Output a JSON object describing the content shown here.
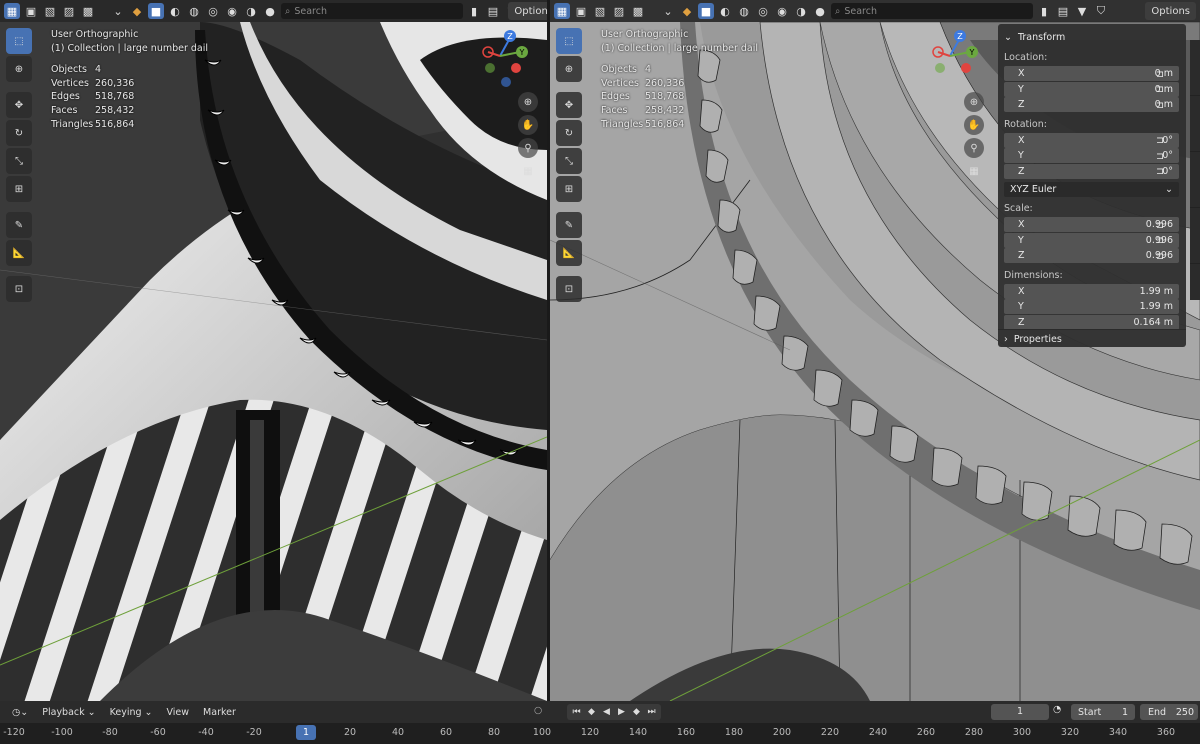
{
  "left_viewport": {
    "search_placeholder": "Search",
    "options_label": "Options",
    "view_name": "User Orthographic",
    "collection": "(1) Collection | large number dail",
    "stats": [
      {
        "label": "Objects",
        "value": "4"
      },
      {
        "label": "Vertices",
        "value": "260,336"
      },
      {
        "label": "Edges",
        "value": "518,768"
      },
      {
        "label": "Faces",
        "value": "258,432"
      },
      {
        "label": "Triangles",
        "value": "516,864"
      }
    ]
  },
  "right_viewport": {
    "search_placeholder": "Search",
    "options_label": "Options",
    "view_name": "User Orthographic",
    "collection": "(1) Collection | large number dail",
    "stats": [
      {
        "label": "Objects",
        "value": "4"
      },
      {
        "label": "Vertices",
        "value": "260,336"
      },
      {
        "label": "Edges",
        "value": "518,768"
      },
      {
        "label": "Faces",
        "value": "258,432"
      },
      {
        "label": "Triangles",
        "value": "516,864"
      }
    ]
  },
  "gizmo_axes": {
    "x": "X",
    "y": "Y",
    "z": "Z"
  },
  "transform_panel": {
    "title": "Transform",
    "location_label": "Location:",
    "location": [
      {
        "axis": "X",
        "value": "0 m"
      },
      {
        "axis": "Y",
        "value": "0 m"
      },
      {
        "axis": "Z",
        "value": "0 m"
      }
    ],
    "rotation_label": "Rotation:",
    "rotation": [
      {
        "axis": "X",
        "value": "0°"
      },
      {
        "axis": "Y",
        "value": "0°"
      },
      {
        "axis": "Z",
        "value": "0°"
      }
    ],
    "rotation_mode": "XYZ Euler",
    "scale_label": "Scale:",
    "scale": [
      {
        "axis": "X",
        "value": "0.996"
      },
      {
        "axis": "Y",
        "value": "0.996"
      },
      {
        "axis": "Z",
        "value": "0.996"
      }
    ],
    "dimensions_label": "Dimensions:",
    "dimensions": [
      {
        "axis": "X",
        "value": "1.99 m"
      },
      {
        "axis": "Y",
        "value": "1.99 m"
      },
      {
        "axis": "Z",
        "value": "0.164 m"
      }
    ],
    "properties_label": "Properties"
  },
  "timeline": {
    "playback_label": "Playback",
    "keying_label": "Keying",
    "view_label": "View",
    "marker_label": "Marker",
    "current_frame": "1",
    "start_label": "Start",
    "start_value": "1",
    "end_label": "End",
    "end_value": "250",
    "ruler_current": "1",
    "ruler_ticks": [
      "-120",
      "-100",
      "-80",
      "-60",
      "-40",
      "-20",
      "20",
      "40",
      "60",
      "80",
      "100",
      "120",
      "140",
      "160",
      "180",
      "200",
      "220",
      "240",
      "260",
      "280",
      "300",
      "320",
      "340",
      "360"
    ]
  },
  "colors": {
    "accent": "#4772b3",
    "axis_x": "#e0443f",
    "axis_y": "#6ba840",
    "axis_z": "#3d7ae0"
  }
}
